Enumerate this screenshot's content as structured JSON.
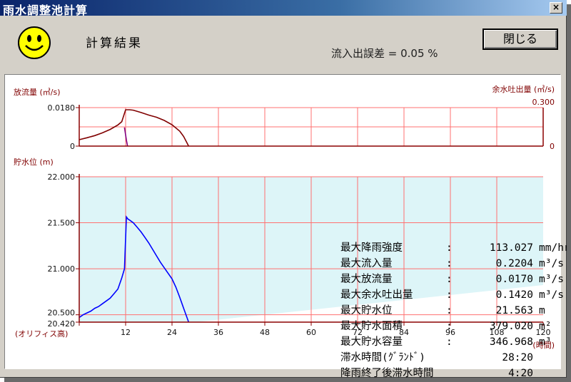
{
  "window": {
    "title": "雨水調整池計算",
    "close_glyph": "×"
  },
  "header": {
    "result_label": "計算結果",
    "close_button": "閉じる",
    "error_text": "流入出誤差 = 0.05 %"
  },
  "stats": [
    {
      "label": "最大降雨強度",
      "colon": ":",
      "value": "113.027",
      "unit": "mm/hr"
    },
    {
      "label": "最大流入量",
      "colon": ":",
      "value": "0.2204",
      "unit": "m³/s"
    },
    {
      "label": "最大放流量",
      "colon": ":",
      "value": "0.0170",
      "unit": "m³/s"
    },
    {
      "label": "最大余水吐出量",
      "colon": ":",
      "value": "0.1420",
      "unit": "m³/s"
    },
    {
      "label": "最大貯水位",
      "colon": ":",
      "value": "21.563",
      "unit": "m"
    },
    {
      "label": "最大貯水面積",
      "colon": ":",
      "value": "379.020",
      "unit": "m²"
    },
    {
      "label": "最大貯水容量",
      "colon": ":",
      "value": "346.968",
      "unit": "m³"
    },
    {
      "label": "滞水時間(ｸﾞﾗﾝﾄﾞ)",
      "colon": "",
      "value": "28:20",
      "unit": ""
    },
    {
      "label": "降雨終了後滞水時間",
      "colon": "",
      "value": "4:20",
      "unit": ""
    }
  ],
  "chart_data": [
    {
      "type": "line",
      "ylabel": "放流量 (㎥/s)",
      "y2label": "余水吐出量 (㎥/s)",
      "ylim": [
        0,
        0.018
      ],
      "y2lim": [
        0,
        0.3
      ],
      "yticks": [
        "0.0180",
        "0"
      ],
      "y2ticks": [
        "0.300",
        "0"
      ],
      "xlim": [
        0,
        120
      ],
      "grid": true,
      "series": [
        {
          "color": "#800000",
          "x": [
            0,
            2,
            4,
            6,
            8,
            10,
            11,
            12,
            13,
            14,
            16,
            18,
            20,
            22,
            24,
            26,
            27,
            28.3
          ],
          "y": [
            0.003,
            0.0039,
            0.0049,
            0.0062,
            0.0078,
            0.0099,
            0.0114,
            0.017,
            0.017,
            0.0168,
            0.0157,
            0.0145,
            0.0135,
            0.012,
            0.01,
            0.007,
            0.0045,
            0.0
          ]
        },
        {
          "color": "#800080",
          "x": [
            11.7,
            12.2,
            12.5
          ],
          "y": [
            0.0087,
            0.0028,
            0.0
          ]
        }
      ]
    },
    {
      "type": "line",
      "ylabel": "貯水位 (m)",
      "xlabel": "(時間)",
      "x0label": "(オリフィス高)",
      "ylim": [
        20.42,
        22.0
      ],
      "yticks": [
        "22.000",
        "21.500",
        "21.000",
        "20.500",
        "20.420"
      ],
      "xticks": [
        "12",
        "24",
        "36",
        "48",
        "60",
        "72",
        "84",
        "96",
        "108",
        "120"
      ],
      "xlim": [
        0,
        120
      ],
      "grid": true,
      "series": [
        {
          "color": "#0000ff",
          "x": [
            0,
            1,
            2,
            3,
            4,
            5,
            6,
            7,
            8,
            9,
            10,
            11,
            11.7,
            12.2,
            12.6,
            13,
            14,
            15,
            16,
            17,
            18,
            19,
            20,
            21,
            22,
            23,
            24,
            25,
            26,
            27,
            28.3
          ],
          "y": [
            20.47,
            20.5,
            20.52,
            20.54,
            20.57,
            20.59,
            20.62,
            20.65,
            20.68,
            20.73,
            20.78,
            20.9,
            21.0,
            21.563,
            21.54,
            21.53,
            21.5,
            21.45,
            21.4,
            21.34,
            21.28,
            21.21,
            21.14,
            21.07,
            21.01,
            20.95,
            20.89,
            20.8,
            20.69,
            20.57,
            20.42
          ]
        }
      ]
    }
  ],
  "colors": {
    "axis": "#8b0000",
    "grid": "#ff7070",
    "storage_fill": "#ddf5f8",
    "outflow_line": "#800000",
    "spill_line": "#800080",
    "level_line": "#0000ff",
    "titlebar": "#0a246a"
  },
  "icons": [
    "smiley-icon",
    "close-icon"
  ]
}
